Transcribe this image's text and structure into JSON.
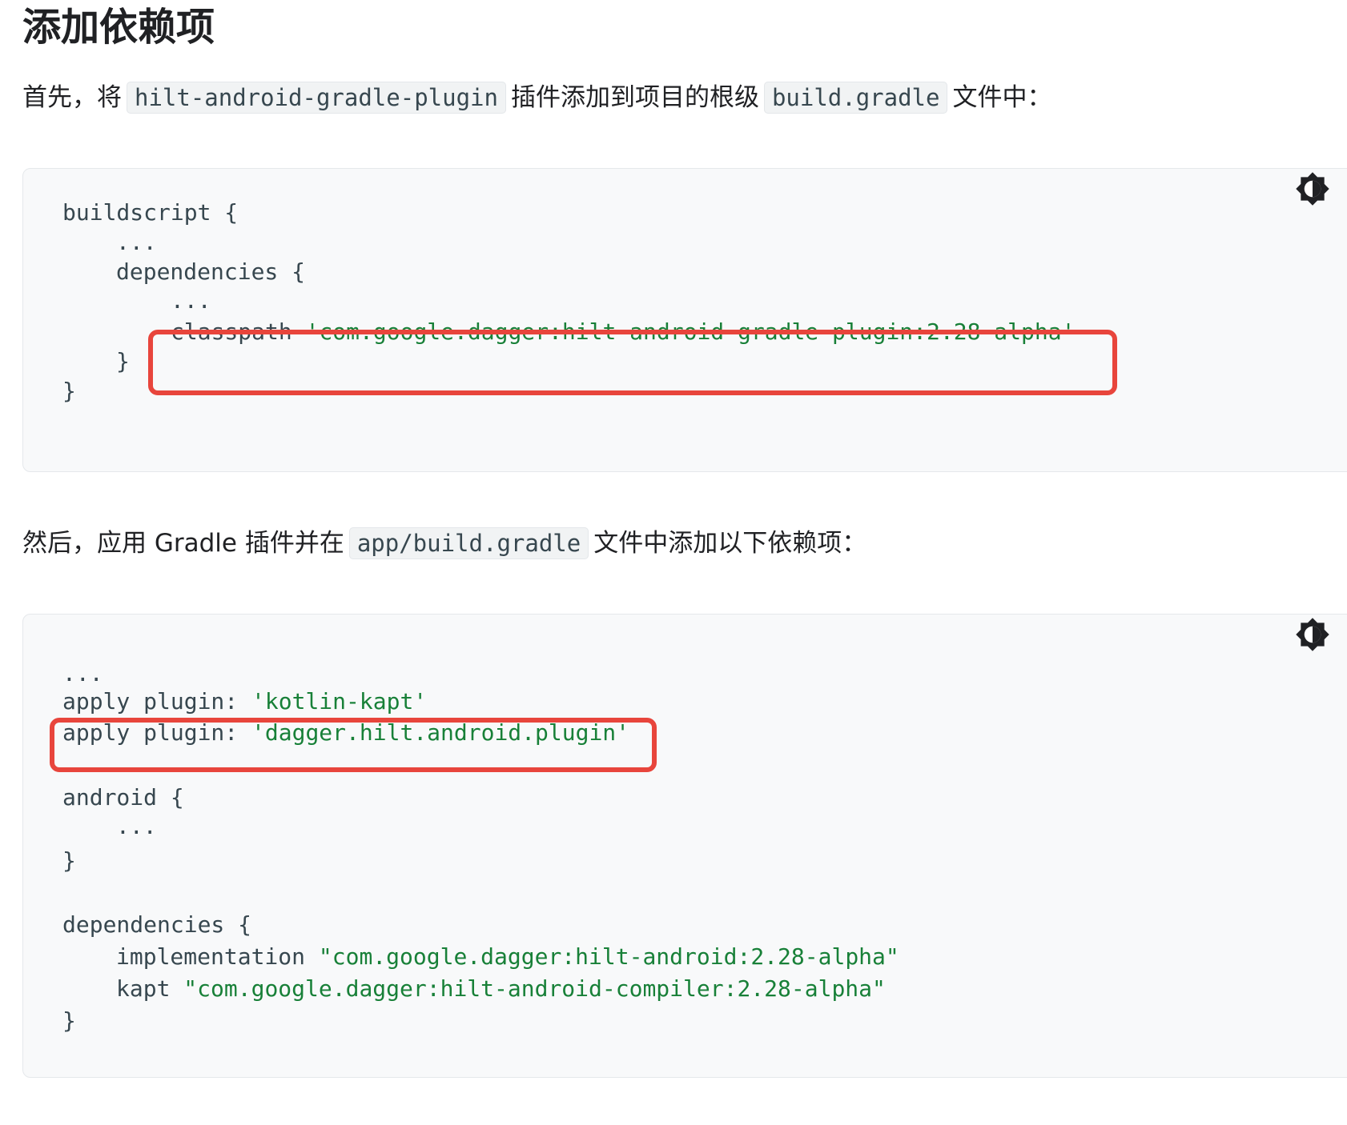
{
  "title": "添加依赖项",
  "para1": {
    "text_before": "首先，将",
    "code1": "hilt-android-gradle-plugin",
    "text_middle": "插件添加到项目的根级",
    "code2": "build.gradle",
    "text_after": "文件中："
  },
  "block1": {
    "lines": [
      "buildscript {",
      "...",
      "dependencies {",
      "...",
      "classpath ",
      "'com.google.dagger:hilt-android-gradle-plugin:2.28-alpha'",
      "}",
      "}"
    ]
  },
  "para2": {
    "text_before": "然后，应用 Gradle 插件并在",
    "code1": "app/build.gradle",
    "text_after": "文件中添加以下依赖项："
  },
  "block2": {
    "lines": [
      "...",
      "apply plugin: ",
      "'kotlin-kapt'",
      "apply plugin: ",
      "'dagger.hilt.android.plugin'",
      "android {",
      "...",
      "}",
      "dependencies {",
      "implementation ",
      "\"com.google.dagger:hilt-android:2.28-alpha\"",
      "kapt ",
      "\"com.google.dagger:hilt-android-compiler:2.28-alpha\"",
      "}"
    ]
  },
  "colors": {
    "string": "#188038",
    "highlight": "#e8453c",
    "code_background": "#f8f9fa"
  },
  "icons": {
    "theme_toggle": "brightness-icon"
  }
}
